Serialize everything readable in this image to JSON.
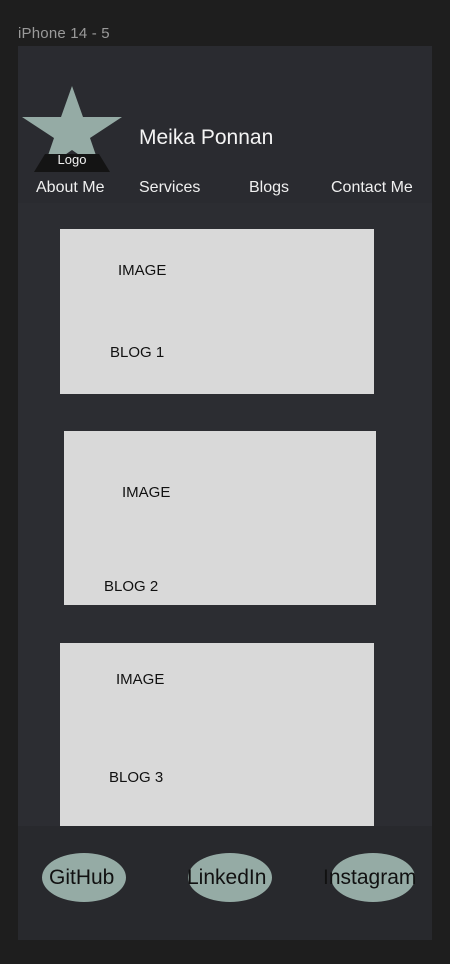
{
  "frame": {
    "label": "iPhone 14 - 5"
  },
  "header": {
    "logo_label": "Logo",
    "logo_color": "#95aba5",
    "site_title": "Meika Ponnan",
    "nav": [
      {
        "label": "About Me"
      },
      {
        "label": "Services"
      },
      {
        "label": "Blogs"
      },
      {
        "label": "Contact Me"
      }
    ]
  },
  "blogs": [
    {
      "image_label": "IMAGE",
      "title": "BLOG 1"
    },
    {
      "image_label": "IMAGE",
      "title": "BLOG 2"
    },
    {
      "image_label": "IMAGE",
      "title": "BLOG 3"
    }
  ],
  "footer": {
    "social": [
      {
        "label": "GitHub"
      },
      {
        "label": "LinkedIn"
      },
      {
        "label": "Instagram"
      }
    ]
  }
}
